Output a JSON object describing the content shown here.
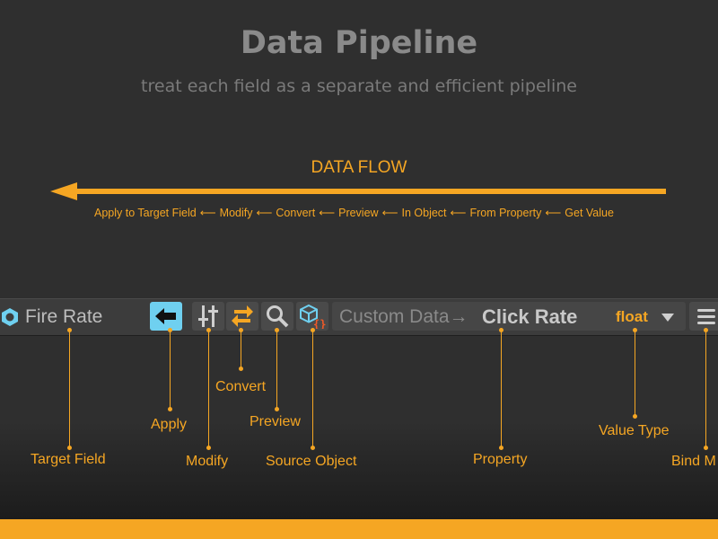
{
  "header": {
    "title": "Data Pipeline",
    "subtitle": "treat each field as a separate and efficient pipeline"
  },
  "flow": {
    "title": "DATA FLOW",
    "arrow_glyph": "⟵",
    "steps": [
      "Apply to Target Field",
      "Modify",
      "Convert",
      "Preview",
      "In Object",
      "From Property",
      "Get Value"
    ]
  },
  "toolbar": {
    "field_name": "Fire Rate",
    "path_prefix": "Custom Data→",
    "path_name": "Click Rate",
    "value_type": "float"
  },
  "callouts": {
    "target_field": "Target Field",
    "apply": "Apply",
    "modify": "Modify",
    "convert": "Convert",
    "preview": "Preview",
    "source_object": "Source Object",
    "property": "Property",
    "value_type": "Value Type",
    "bind_mode": "Bind M"
  },
  "colors": {
    "accent": "#f5a623",
    "active_button": "#6fd0f0",
    "background": "#2f2f2f"
  },
  "icons": [
    "hexagon-icon",
    "arrow-left-icon",
    "sliders-icon",
    "swap-arrows-icon",
    "search-icon",
    "cube-braces-icon",
    "chevron-down-icon",
    "hamburger-menu-icon"
  ]
}
